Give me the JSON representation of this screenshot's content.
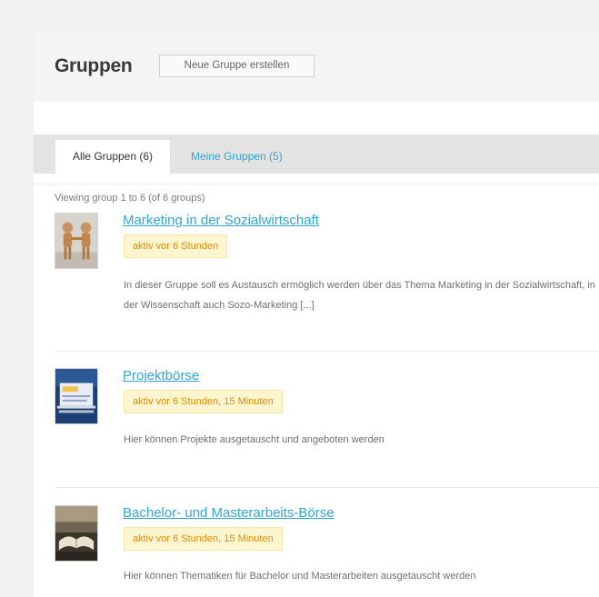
{
  "header": {
    "title": "Gruppen",
    "create_button": "Neue Gruppe erstellen"
  },
  "tabs": [
    {
      "label": "Alle Gruppen (6)",
      "active": true
    },
    {
      "label": "Meine Gruppen (5)",
      "active": false
    }
  ],
  "viewing_text": "Viewing group 1 to 6 (of 6 groups)",
  "groups": [
    {
      "title": "Marketing in der Sozialwirtschaft",
      "activity": "aktiv vor 6 Stunden",
      "description": "In dieser Gruppe soll es Austausch ermöglich werden über das Thema Marketing in der Sozialwirtschaft, in der Wissenschaft auch Sozo-Marketing [...]",
      "icon": "handshake-figures-avatar"
    },
    {
      "title": "Projektbörse",
      "activity": "aktiv vor 6 Stunden, 15 Minuten",
      "description": "Hier können Projekte ausgetauscht und angeboten werden",
      "icon": "project-folder-avatar"
    },
    {
      "title": "Bachelor- und Masterarbeits-Börse",
      "activity": "aktiv vor 6 Stunden, 15 Minuten",
      "description": "Hier können Thematiken für Bachelor und Masterarbeiten ausgetauscht werden",
      "icon": "open-book-avatar"
    }
  ],
  "colors": {
    "accent": "#2fa6d4",
    "activity_bg": "#fff6d0",
    "activity_text": "#e48b00",
    "tabs_bg": "#e3e3e3"
  }
}
